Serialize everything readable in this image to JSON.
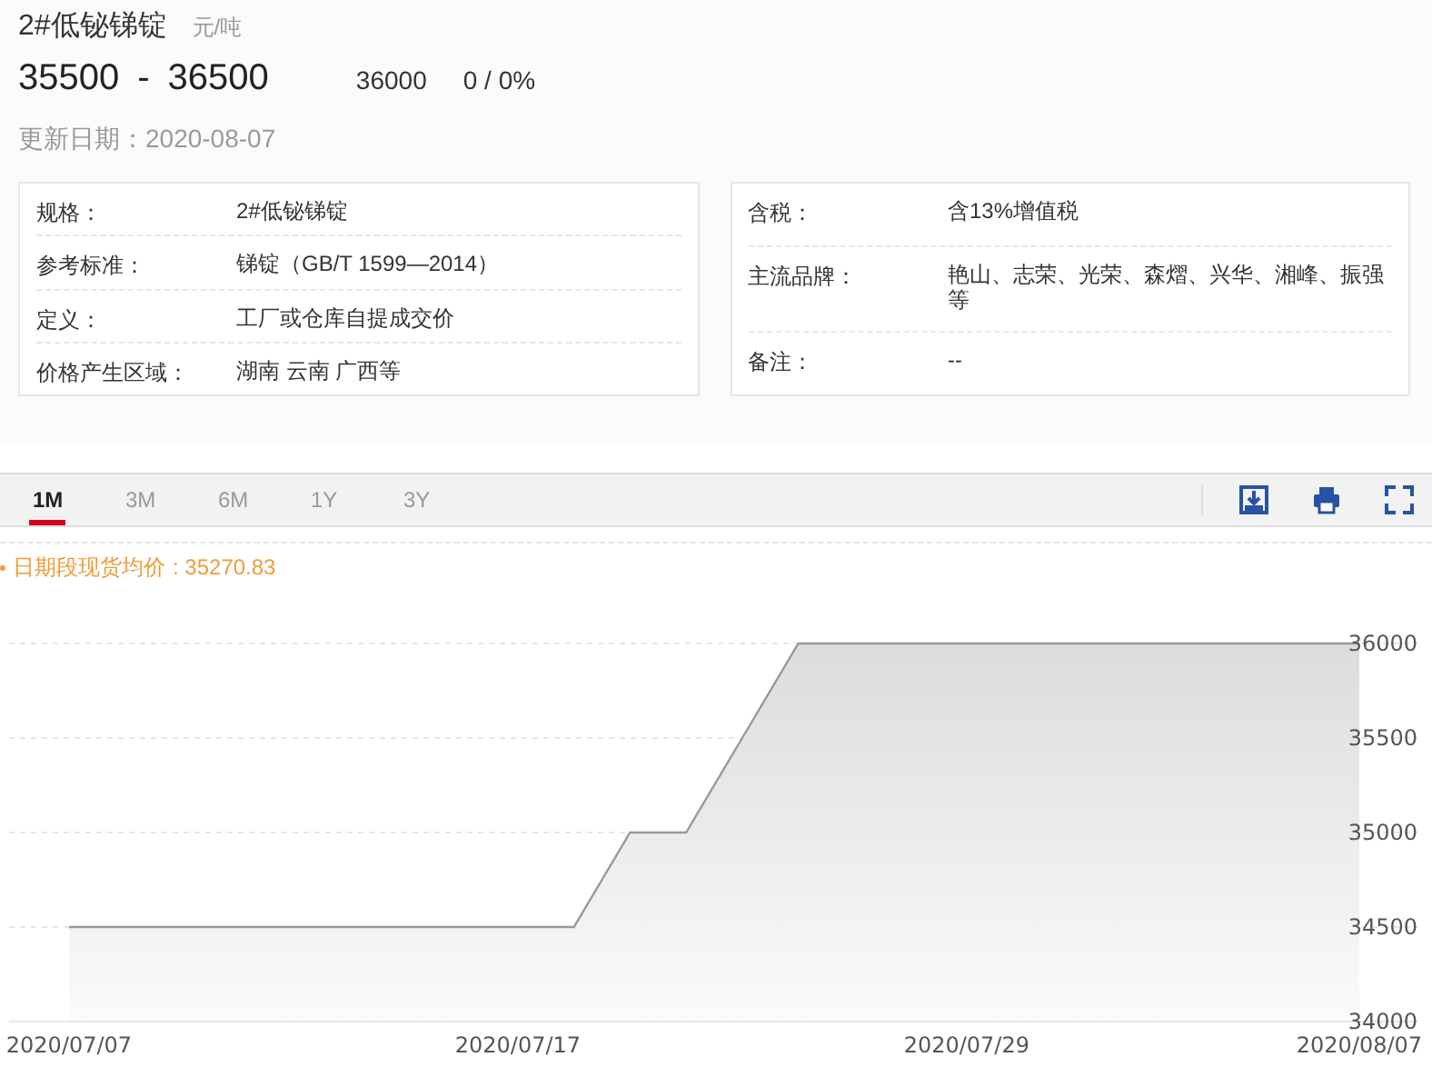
{
  "product": {
    "name": "2#低铋锑锭",
    "unit": "元/吨"
  },
  "price": {
    "range_low": "35500",
    "separator": "-",
    "range_high": "36500",
    "average": "36000",
    "change": "0 / 0%"
  },
  "updated": "更新日期：2020-08-07",
  "specs_left": [
    {
      "label": "规格：",
      "value": "2#低铋锑锭"
    },
    {
      "label": "参考标准：",
      "value": "锑锭（GB/T 1599—2014）"
    },
    {
      "label": "定义：",
      "value": "工厂或仓库自提成交价"
    },
    {
      "label": "价格产生区域：",
      "value": "湖南 云南 广西等"
    }
  ],
  "specs_right": [
    {
      "label": "含税：",
      "value": "含13%增值税"
    },
    {
      "label": "主流品牌：",
      "value": "艳山、志荣、光荣、森熠、兴华、湘峰、振强等"
    },
    {
      "label": "备注：",
      "value": "--"
    }
  ],
  "tabs": [
    {
      "label": "1M",
      "selected": true
    },
    {
      "label": "3M",
      "selected": false
    },
    {
      "label": "6M",
      "selected": false
    },
    {
      "label": "1Y",
      "selected": false
    },
    {
      "label": "3Y",
      "selected": false
    }
  ],
  "chart": {
    "legend_value": ": 35270.83",
    "chart_data": {
      "type": "area",
      "categories": [
        "2020/07/07",
        null,
        null,
        null,
        null,
        null,
        null,
        null,
        "2020/07/17",
        null,
        null,
        null,
        null,
        null,
        null,
        null,
        "2020/07/29",
        null,
        null,
        null,
        null,
        null,
        null,
        "2020/08/07"
      ],
      "series": [
        {
          "name": "日期段现货均价",
          "color": "#999999",
          "values": [
            34500,
            34500,
            34500,
            34500,
            34500,
            34500,
            34500,
            34500,
            34500,
            34500,
            35000,
            35000,
            35500,
            36000,
            36000,
            36000,
            36000,
            36000,
            36000,
            36000,
            36000,
            36000,
            36000,
            36000
          ]
        }
      ],
      "grid": true,
      "ylim": [
        34000,
        36000
      ],
      "yticks": [
        34000,
        34500,
        35000,
        35500,
        36000
      ]
    }
  }
}
